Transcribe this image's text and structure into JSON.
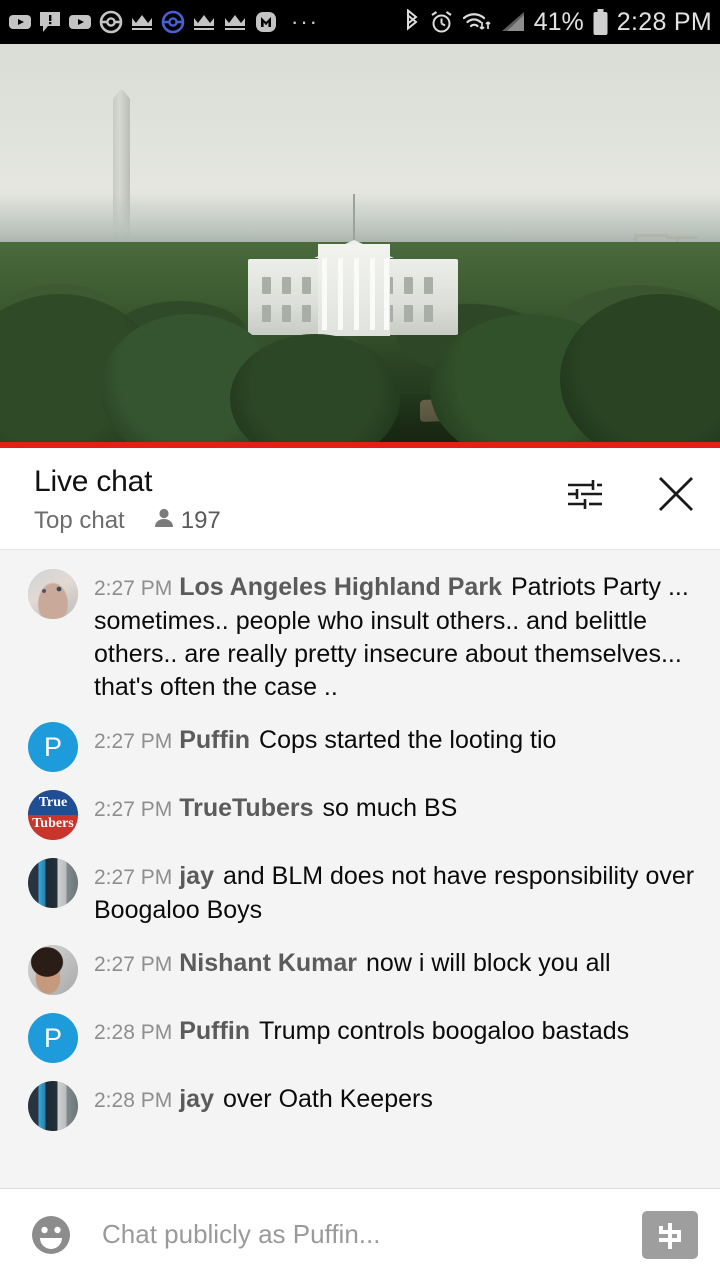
{
  "status_bar": {
    "icons": [
      {
        "name": "youtube-icon",
        "glyph": "youtube"
      },
      {
        "name": "message-alert-icon",
        "glyph": "msg-alert"
      },
      {
        "name": "youtube-music-icon",
        "glyph": "youtube"
      },
      {
        "name": "pokeball-icon",
        "glyph": "pokeball"
      },
      {
        "name": "crown-icon",
        "glyph": "crown"
      },
      {
        "name": "pokeball-blue-icon",
        "glyph": "pokeball-blue"
      },
      {
        "name": "crown-icon-2",
        "glyph": "crown"
      },
      {
        "name": "crown-icon-3",
        "glyph": "crown"
      },
      {
        "name": "m-app-icon",
        "glyph": "m-badge"
      }
    ],
    "overflow": "···",
    "bluetooth_icon": "bluetooth-icon",
    "alarm_icon": "alarm-icon",
    "wifi_icon": "wifi-icon",
    "signal_icon": "cellular-signal-icon",
    "battery_percent": "41%",
    "battery_icon": "battery-icon",
    "time": "2:28 PM"
  },
  "video": {
    "name": "live-video-player",
    "scene_description": "White House and Washington Monument live stream",
    "progress_percent": 100,
    "progress_color": "#e81e10"
  },
  "chat_header": {
    "title": "Live chat",
    "mode": "Top chat",
    "viewer_icon": "person-icon",
    "viewer_count": "197",
    "settings_icon": "chat-settings-icon",
    "close_icon": "close-icon"
  },
  "messages": [
    {
      "avatar_type": "cat",
      "avatar_label": "",
      "time": "2:27 PM",
      "author": "Los Angeles Highland Park",
      "text": "Patriots Party ... sometimes.. people who insult others.. and belittle others.. are really pretty insecure about themselves... that's often the case .."
    },
    {
      "avatar_type": "letter",
      "avatar_label": "P",
      "time": "2:27 PM",
      "author": "Puffin",
      "text": "Cops started the looting tio"
    },
    {
      "avatar_type": "truetubers",
      "avatar_label": "",
      "avatar_text_top": "True",
      "avatar_text_bottom": "Tubers",
      "time": "2:27 PM",
      "author": "TrueTubers",
      "text": "so much BS"
    },
    {
      "avatar_type": "jay",
      "avatar_label": "",
      "time": "2:27 PM",
      "author": "jay",
      "text": "and BLM does not have responsibility over Boogaloo Boys"
    },
    {
      "avatar_type": "nishant",
      "avatar_label": "",
      "time": "2:27 PM",
      "author": "Nishant Kumar",
      "text": "now i will block you all"
    },
    {
      "avatar_type": "letter",
      "avatar_label": "P",
      "time": "2:28 PM",
      "author": "Puffin",
      "text": "Trump controls boogaloo bastads"
    },
    {
      "avatar_type": "jay",
      "avatar_label": "",
      "time": "2:28 PM",
      "author": "jay",
      "text": "over Oath Keepers"
    }
  ],
  "input_bar": {
    "emoji_icon": "emoji-smiley-icon",
    "placeholder": "Chat publicly as Puffin...",
    "value": "",
    "superchat_icon": "super-chat-dollar-icon"
  },
  "colors": {
    "accent_red": "#e81e10",
    "chat_bg": "#f4f4f4",
    "avatar_blue": "#1e9bda",
    "status_bar_bg": "#000000"
  }
}
